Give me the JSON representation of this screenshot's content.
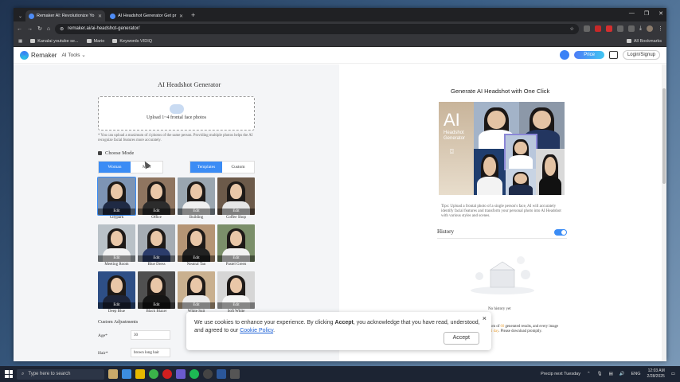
{
  "browser": {
    "tabs": [
      {
        "title": "Remaker AI: Revolutionize Yo",
        "active": true
      },
      {
        "title": "AI Headshot Generator Get pr",
        "active": false
      }
    ],
    "new_tab": "+",
    "url": "remaker.ai/ai-headshot-generator/",
    "bookmarks": [
      "Kanalai youtube se...",
      "Mario",
      "Keywords VIDIQ"
    ],
    "all_bookmarks": "All Bookmarks"
  },
  "site": {
    "brand": "Remaker",
    "ai_tools": "AI Tools",
    "price": "Price",
    "login": "Login/Signup"
  },
  "left": {
    "title": "AI Headshot Generator",
    "upload_text": "Upload 1~4 frontal face photos",
    "note": "* You can upload a maximum of 4 photos of the same person. Providing multiple photos helps the AI recognize facial features more accurately.",
    "choose_mode": "Choose Mode",
    "gender": [
      "Woman",
      "Man"
    ],
    "style_mode": [
      "Templates",
      "Custom"
    ],
    "edit_label": "Edit",
    "templates": [
      {
        "name": "Citypark",
        "bg": "#7d94b4",
        "suit": "#1f2a44"
      },
      {
        "name": "Office",
        "bg": "#8f7560",
        "suit": "#2c2c2c"
      },
      {
        "name": "Building",
        "bg": "#9aa6b0",
        "suit": "#f0f0f0"
      },
      {
        "name": "Coffee Shop",
        "bg": "#6c5a4a",
        "suit": "#e6e6e6"
      },
      {
        "name": "Meeting Room",
        "bg": "#b9c1c7",
        "suit": "#f3f3f3"
      },
      {
        "name": "Blue Dress",
        "bg": "#a5acb3",
        "suit": "#2b3c6b"
      },
      {
        "name": "Neutral Tan",
        "bg": "#b59575",
        "suit": "#222222"
      },
      {
        "name": "Pastel Green",
        "bg": "#7b8f6a",
        "suit": "#f2f2f2"
      },
      {
        "name": "Deep Blue",
        "bg": "#2e4f86",
        "suit": "#1d2438"
      },
      {
        "name": "Black Blazer",
        "bg": "#505050",
        "suit": "#151515"
      },
      {
        "name": "White Suit",
        "bg": "#c9b08f",
        "suit": "#ececec"
      },
      {
        "name": "Soft White",
        "bg": "#d6d6d6",
        "suit": "#f6f6f6"
      }
    ],
    "custom_adjustments": "Custom Adjustments",
    "age_label": "Age*",
    "age_value": "30",
    "hair_label": "Hair*",
    "hair_value": "brown long hair"
  },
  "right": {
    "title": "Generate AI Headshot with One Click",
    "banner_ai": "AI",
    "banner_text": "Headshot Generator",
    "tips": "Tips: Upload a frontal photo of a single person's face, AI will accurately identify facial features and transform your personal photo into AI Headshot with various styles and scenes.",
    "history": "History",
    "empty": "No history yet",
    "partial_a": "om of ",
    "partial_num": "60",
    "partial_b": " generated results, and every image",
    "partial_c": "1 day",
    "partial_d": ". Please download promptly."
  },
  "cookie": {
    "text_a": "We use cookies to enhance your experience. By clicking ",
    "accept_word": "Accept",
    "text_b": ", you acknowledge that you have read, understood, and agreed to our ",
    "policy": "Cookie Policy",
    "text_c": ".",
    "accept_button": "Accept",
    "close": "×"
  },
  "taskbar": {
    "search": "Type here to search",
    "weather": "Precip next Tuesday",
    "lang": "ENG",
    "time": "12:03 AM",
    "date": "2/28/2025"
  }
}
